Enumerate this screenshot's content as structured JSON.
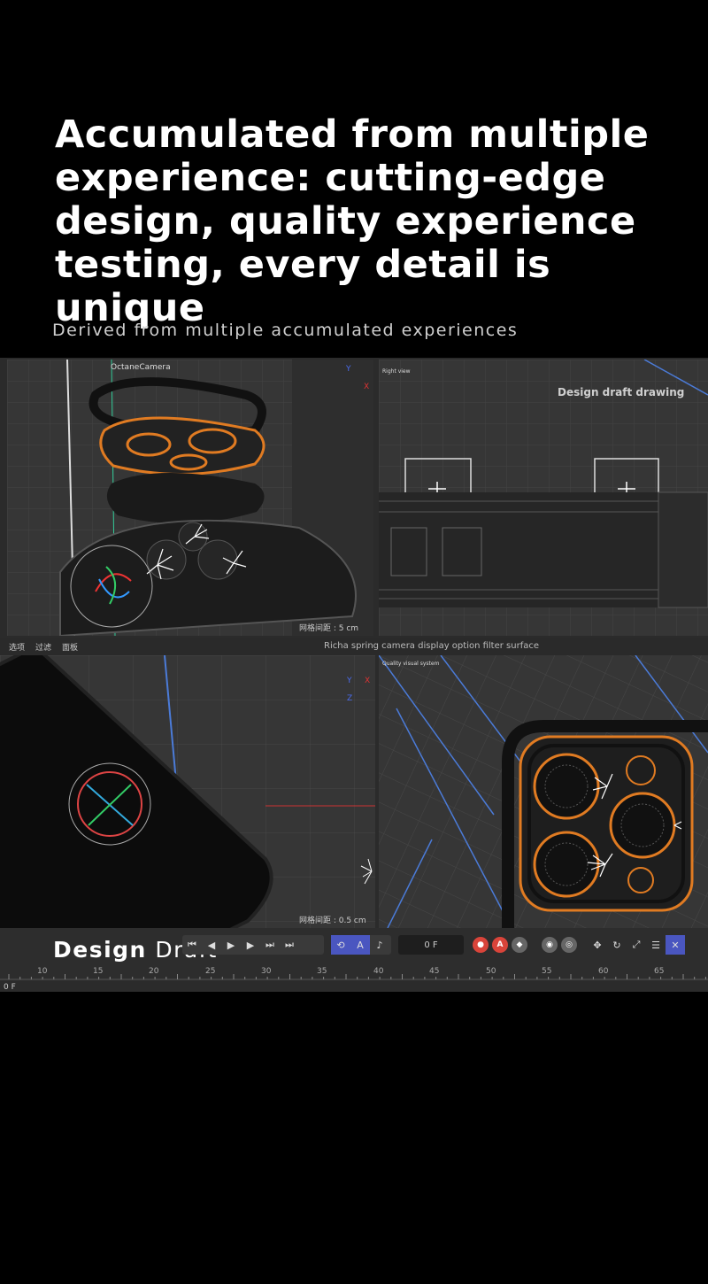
{
  "headline": "Accumulated from multiple experience: cutting-edge design, quality experience testing, every detail is unique",
  "subline": "Derived from multiple accumulated experiences",
  "viewports": {
    "top_left": {
      "camera_label": "OctaneCamera",
      "grid_spacing": "网格间距 : 5 cm",
      "axis_y": "Y",
      "axis_x": "X"
    },
    "top_right": {
      "tag": "Right view",
      "title": "Design draft drawing"
    },
    "bottom_left": {
      "grid_spacing": "网格间距 : 0.5 cm",
      "axis_y": "Y",
      "axis_x": "X",
      "axis_z": "Z"
    },
    "bottom_right": {
      "tag": "Quality visual system"
    }
  },
  "menubar": {
    "items": [
      "选项",
      "过滤",
      "面板"
    ],
    "caption": "Richa spring camera display option filter surface"
  },
  "caption": {
    "bold": "Design",
    "normal": "Draft"
  },
  "timeline": {
    "current_frame": "0 F",
    "frame_readout": "0 F",
    "ticks": [
      "10",
      "15",
      "20",
      "25",
      "30",
      "35",
      "40",
      "45",
      "50",
      "55",
      "60",
      "65"
    ]
  },
  "icons": {
    "transport": [
      "skip-start-icon",
      "step-back-icon",
      "play-icon",
      "step-forward-icon",
      "next-key-icon",
      "skip-end-icon"
    ],
    "record": [
      "record-icon",
      "auto-key-icon",
      "keyframe-icon"
    ]
  },
  "colors": {
    "accent_orange": "#e07b22",
    "viewport_bg": "#363636",
    "grid": "#444444"
  }
}
